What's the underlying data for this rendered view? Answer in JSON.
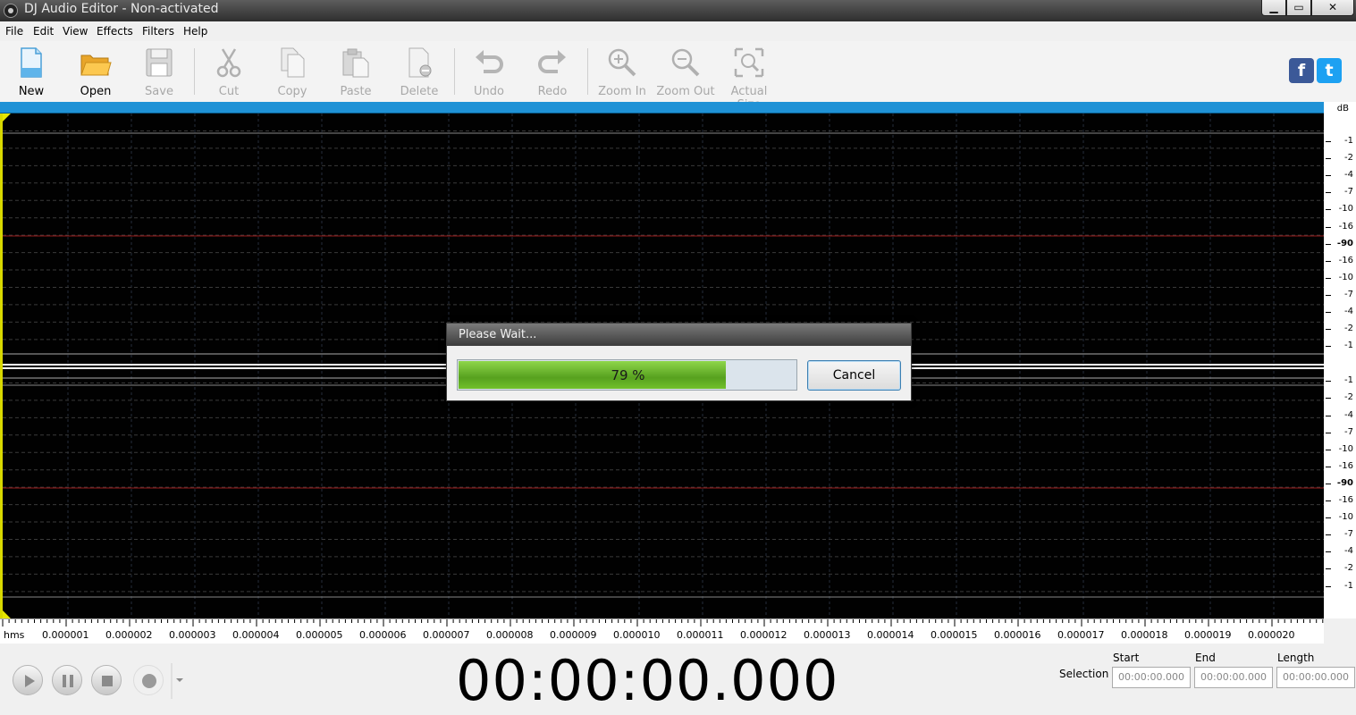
{
  "window": {
    "title": "DJ Audio Editor - Non-activated",
    "minimize": "▁",
    "maximize": "▭",
    "close": "✕"
  },
  "menu": [
    "File",
    "Edit",
    "View",
    "Effects",
    "Filters",
    "Help"
  ],
  "toolbar": {
    "new": "New",
    "open": "Open",
    "save": "Save",
    "cut": "Cut",
    "copy": "Copy",
    "paste": "Paste",
    "delete": "Delete",
    "undo": "Undo",
    "redo": "Redo",
    "zoom_in": "Zoom In",
    "zoom_out": "Zoom Out",
    "actual_size": "Actual Size"
  },
  "social": {
    "facebook": "f",
    "twitter": "t"
  },
  "db_scale": {
    "unit": "dB",
    "labels": [
      "-1",
      "-2",
      "-4",
      "-7",
      "-10",
      "-16",
      "-90",
      "-16",
      "-10",
      "-7",
      "-4",
      "-2",
      "-1",
      "-1",
      "-2",
      "-4",
      "-7",
      "-10",
      "-16",
      "-90",
      "-16",
      "-10",
      "-7",
      "-4",
      "-2",
      "-1"
    ]
  },
  "ruler": {
    "unit": "hms",
    "labels": [
      "0.000001",
      "0.000002",
      "0.000003",
      "0.000004",
      "0.000005",
      "0.000006",
      "0.000007",
      "0.000008",
      "0.000009",
      "0.000010",
      "0.000011",
      "0.000012",
      "0.000013",
      "0.000014",
      "0.000015",
      "0.000016",
      "0.000017",
      "0.000018",
      "0.000019",
      "0.000020"
    ]
  },
  "dialog": {
    "title": "Please Wait...",
    "progress_percent": 79,
    "progress_text": "79 %",
    "cancel": "Cancel"
  },
  "transport": {
    "time": "00:00:00.000"
  },
  "selection": {
    "label": "Selection",
    "start_label": "Start",
    "end_label": "End",
    "length_label": "Length",
    "start": "00:00:00.000",
    "end": "00:00:00.000",
    "length": "00:00:00.000"
  },
  "colors": {
    "waveform_bg": "#010101",
    "overview_bar": "#1f92d6",
    "progress_green": "#6cbf2a",
    "grid": "#3a3a3a",
    "red_line": "#9b1c1c"
  }
}
